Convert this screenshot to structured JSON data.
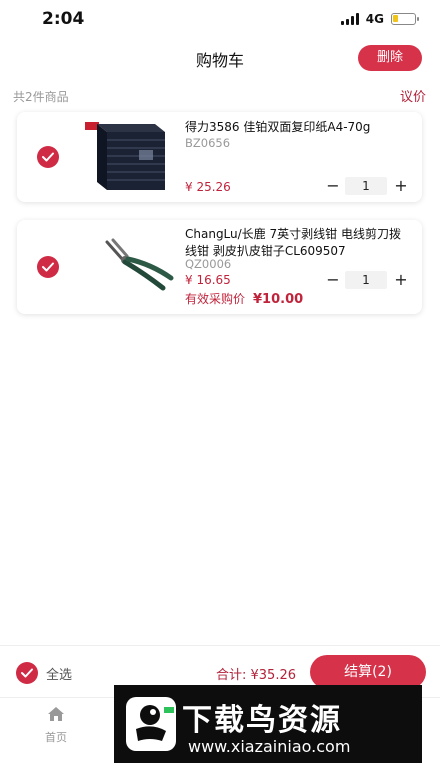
{
  "status_bar": {
    "time": "2:04",
    "network": "4G"
  },
  "header": {
    "title": "购物车",
    "delete_label": "删除"
  },
  "summary": {
    "count_text": "共2件商品",
    "negotiate_label": "议价"
  },
  "items": [
    {
      "name": "得力3586 佳铂双面复印纸A4-70g",
      "sku": "BZ0656",
      "price": "¥ 25.26",
      "qty": "1",
      "checked": true
    },
    {
      "name": "ChangLu/长鹿 7英寸剥线钳 电线剪刀拨线钳 剥皮扒皮钳子CL609507",
      "sku": "QZ0006",
      "price": "¥ 16.65",
      "effective_label": "有效采购价",
      "effective_price": "¥10.00",
      "qty": "1",
      "checked": true
    }
  ],
  "stepper": {
    "minus": "−",
    "plus": "+"
  },
  "bottom_bar": {
    "select_all_label": "全选",
    "total_text": "合计: ¥35.26",
    "checkout_label": "结算(2)"
  },
  "tabbar": {
    "home_label": "首页"
  },
  "watermark": {
    "title": "下载鸟资源",
    "url": "www.xiazainiao.com"
  },
  "colors": {
    "accent": "#d6324a",
    "price": "#c0243c",
    "muted": "#999999"
  }
}
